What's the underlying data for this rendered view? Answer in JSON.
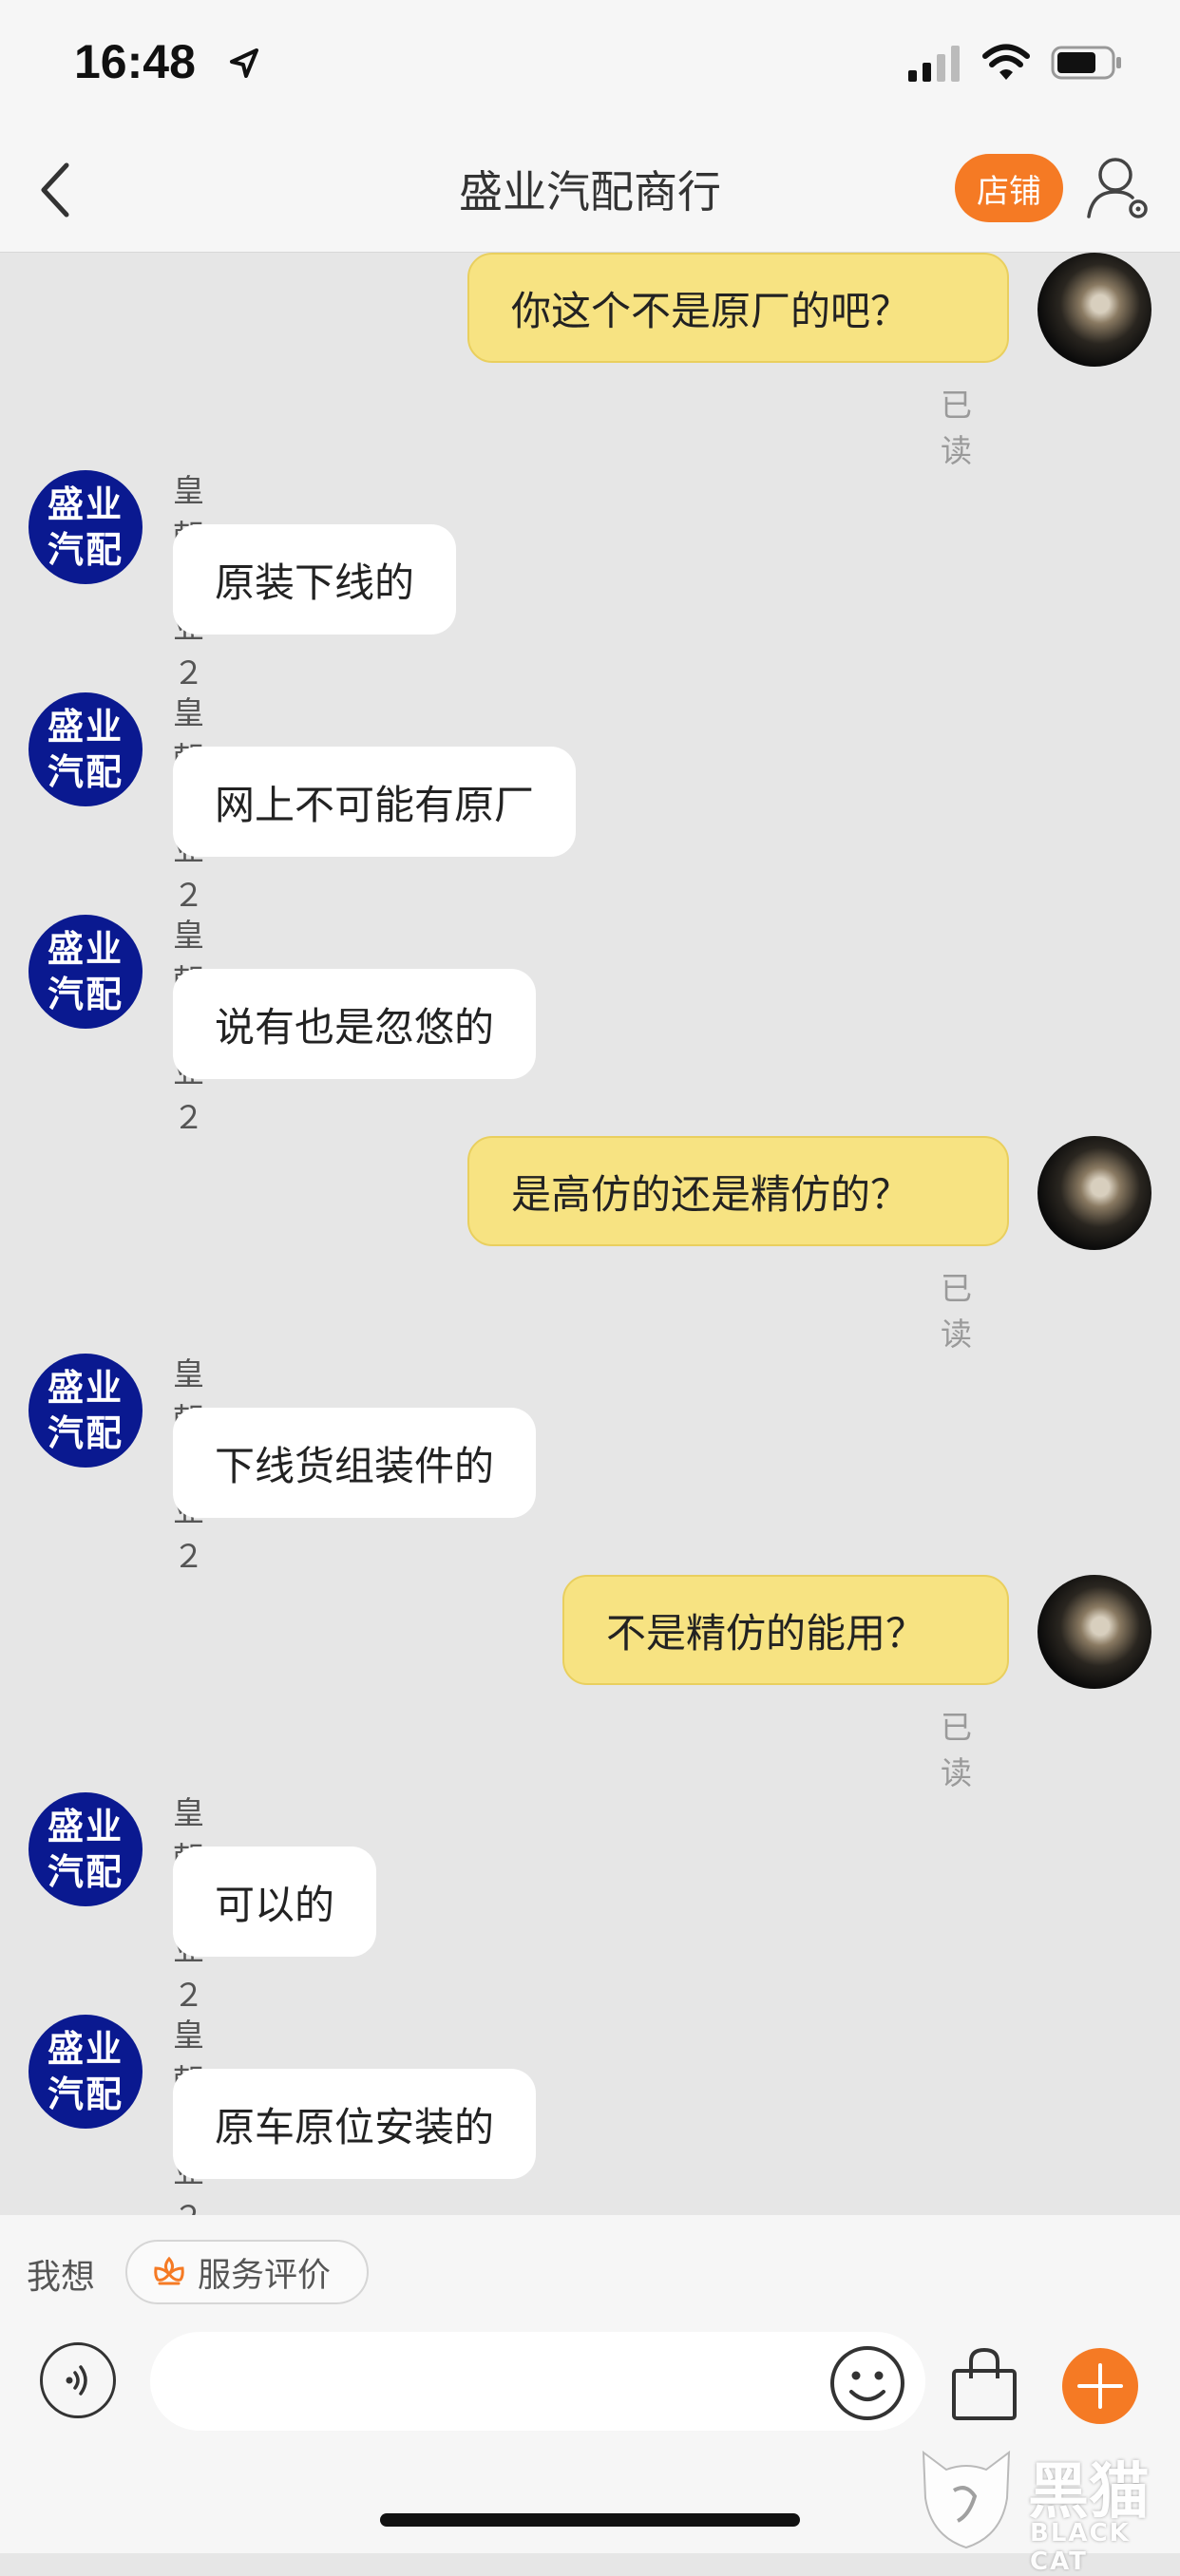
{
  "status_bar": {
    "time": "16:48"
  },
  "header": {
    "title": "盛业汽配商行",
    "shop_label": "店铺"
  },
  "messages": [
    {
      "side": "out",
      "text": "你这个不是原厂的吧？",
      "status": "已读"
    },
    {
      "side": "in",
      "sender": "皇朝盛业２",
      "avatar_text": "盛业汽配",
      "text": "原装下线的"
    },
    {
      "side": "in",
      "sender": "皇朝盛业２",
      "avatar_text": "盛业汽配",
      "text": "网上不可能有原厂"
    },
    {
      "side": "in",
      "sender": "皇朝盛业２",
      "avatar_text": "盛业汽配",
      "text": "说有也是忽悠的"
    },
    {
      "side": "out",
      "text": "是高仿的还是精仿的？",
      "status": "已读"
    },
    {
      "side": "in",
      "sender": "皇朝盛业２",
      "avatar_text": "盛业汽配",
      "text": "下线货组装件的"
    },
    {
      "side": "out",
      "text": "不是精仿的能用？",
      "status": "已读"
    },
    {
      "side": "in",
      "sender": "皇朝盛业２",
      "avatar_text": "盛业汽配",
      "text": "可以的"
    },
    {
      "side": "in",
      "sender": "皇朝盛业２",
      "avatar_text": "盛业汽配",
      "text": "原车原位安装的"
    }
  ],
  "suggestions": {
    "label": "我想",
    "service_review": "服务评价"
  },
  "input": {
    "placeholder": ""
  },
  "watermark": {
    "cn": "黑猫",
    "en": "BLACK CAT"
  },
  "colors": {
    "accent": "#f57a24",
    "shop_avatar": "#0a1990",
    "out_bubble": "#f7e382"
  }
}
